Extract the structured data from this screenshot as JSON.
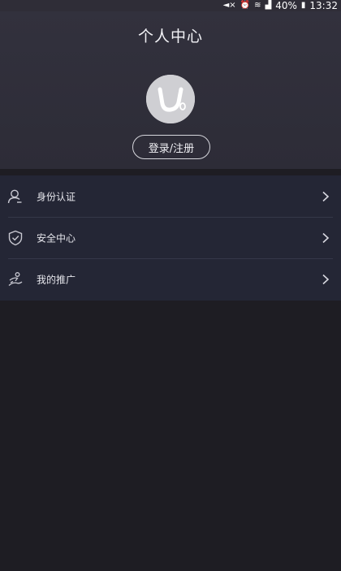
{
  "status_bar": {
    "battery": "40%",
    "time": "13:32",
    "icons": [
      "mute-icon",
      "alarm-icon",
      "wifi-icon",
      "signal-icon",
      "battery-icon"
    ]
  },
  "header": {
    "title": "个人中心",
    "avatar_icon": "app-logo-avatar-icon",
    "login_button": "登录/注册"
  },
  "menu": {
    "items": [
      {
        "label": "身份认证",
        "icon": "person-icon"
      },
      {
        "label": "安全中心",
        "icon": "shield-check-icon"
      },
      {
        "label": "我的推广",
        "icon": "promotion-icon"
      }
    ]
  },
  "colors": {
    "background": "#1e1d23",
    "header": "#2f2e39",
    "menu": "#242635",
    "text": "#e6e6ec"
  }
}
